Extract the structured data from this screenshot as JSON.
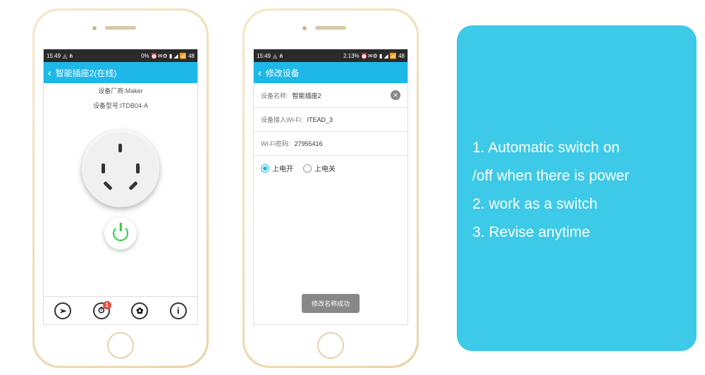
{
  "phone1": {
    "status": {
      "time": "15:49",
      "right": "0% ⏰✉⚙ ▮ ◢ 📶 48"
    },
    "header": {
      "back": "‹",
      "title": "智能插座2(在线)"
    },
    "info1": "设备厂商:Maker",
    "info2": "设备型号:ITDB04-A",
    "bottombar": {
      "share": "➢",
      "timer": "⏱",
      "timer_badge": "1",
      "settings": "✿",
      "info": "i"
    }
  },
  "phone2": {
    "status": {
      "time": "15:49",
      "right": "2.13% ⏰✉⚙ ▮ ◢ 📶 48"
    },
    "header": {
      "back": "‹",
      "title": "修改设备"
    },
    "row_name": {
      "label": "设备名称:",
      "value": "智能插座2"
    },
    "row_wifi": {
      "label": "设备接入Wi-Fi:",
      "value": "ITEAD_3"
    },
    "row_pwd": {
      "label": "Wi-Fi密码:",
      "value": "27955416"
    },
    "radio_on": "上电开",
    "radio_off": "上电关",
    "toast": "修改名称成功"
  },
  "panel": {
    "line1": "1. Automatic switch on",
    "line2": "/off when there is power",
    "line3": "2. work as a switch",
    "line4": "3. Revise anytime"
  }
}
